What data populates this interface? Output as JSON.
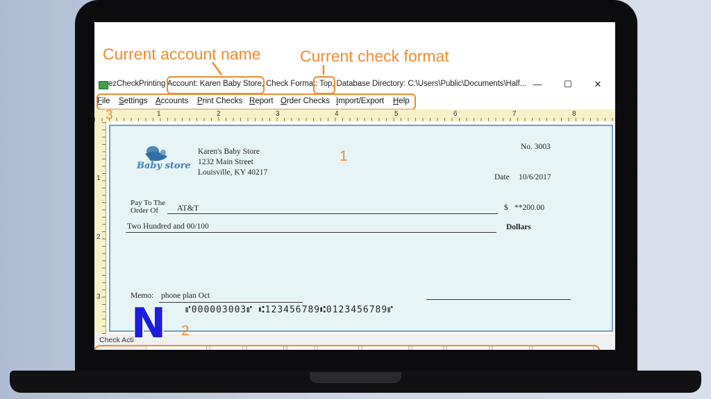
{
  "annotations": {
    "account_label": "Current account name",
    "format_label": "Current check format",
    "num_1": "1",
    "num_2": "2",
    "num_3": "3",
    "color": "#ef8b2a"
  },
  "window": {
    "title": "ezCheckPrinting  Account: Karen Baby Store, Check Format: Top, Database Directory: C:\\Users\\Public\\Documents\\Half...",
    "minimize": "—",
    "maximize": "☐",
    "close": "✕"
  },
  "menu": [
    "File",
    "Settings",
    "Accounts",
    "Print Checks",
    "Report",
    "Order Checks",
    "Import/Export",
    "Help"
  ],
  "ruler": {
    "h_marks": [
      "1",
      "2",
      "3",
      "4",
      "5",
      "6",
      "7",
      "8"
    ],
    "v_marks": [
      "1",
      "2",
      "3"
    ]
  },
  "check": {
    "logo_text": "Baby store",
    "payer_name": "Karen's Baby Store",
    "address1": "1232 Main Street",
    "address2": "Louisville, KY 40217",
    "check_no": "No. 3003",
    "date_label": "Date",
    "date_value": "10/6/2017",
    "pay_to_line1": "Pay To The",
    "pay_to_line2": "Order Of",
    "payee": "AT&T",
    "dollar_sign": "$",
    "amount": "**200.00",
    "amount_words": "Two Hundred  and 00/100",
    "dollars_label": "Dollars",
    "memo_label": "Memo:",
    "memo_value": "phone plan Oct",
    "micr": "⑈000003003⑈ ⑆123456789⑆0123456789⑈"
  },
  "bottom": {
    "label": "Check Acti"
  },
  "logo_letter": "N"
}
